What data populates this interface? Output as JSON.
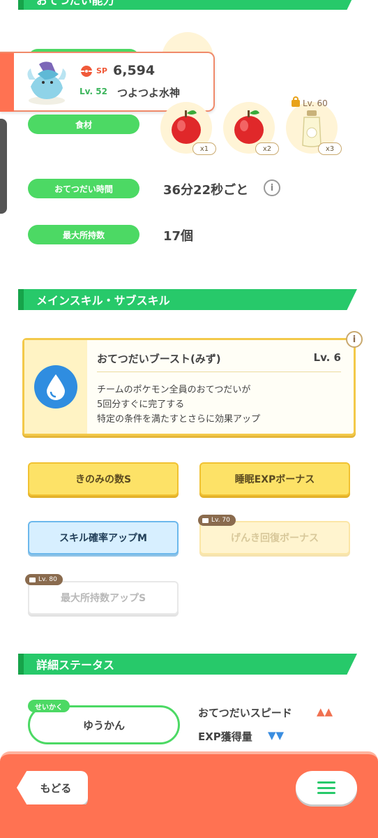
{
  "top_section": {
    "title": "おてつだい能力"
  },
  "pokemon_card": {
    "sp_label": "SP",
    "sp_value": "6,594",
    "level": "Lv. 52",
    "nickname": "つよつよ水神"
  },
  "stats": {
    "ingredients_label": "食材",
    "ingredients": [
      {
        "name": "apple-icon",
        "qty": "x1",
        "locked": false
      },
      {
        "name": "apple-icon",
        "qty": "x2",
        "locked": false
      },
      {
        "name": "oil-bottle-icon",
        "qty": "x3",
        "locked": true,
        "lock_level": "Lv. 60"
      }
    ],
    "help_time_label": "おてつだい時間",
    "help_time_value": "36分22秒ごと",
    "max_carry_label": "最大所持数",
    "max_carry_value": "17個"
  },
  "skills_section": {
    "title": "メインスキル・サブスキル",
    "main_skill": {
      "name": "おてつだいブースト(みず)",
      "level": "Lv. 6",
      "desc_1": "チームのポケモン全員のおてつだいが",
      "desc_2": "5回分すぐに完了する",
      "desc_3": "特定の条件を満たすとさらに効果アップ",
      "info_icon": "i"
    },
    "sub_skills": [
      {
        "label": "きのみの数S"
      },
      {
        "label": "睡眠EXPボーナス"
      },
      {
        "label": "スキル確率アップM"
      },
      {
        "label": "げんき回復ボーナス",
        "lock_level": "Lv. 70"
      },
      {
        "label": "最大所持数アップS",
        "lock_level": "Lv. 80"
      }
    ]
  },
  "detail_section": {
    "title": "詳細ステータス",
    "nature_tag": "せいかく",
    "nature": "ゆうかん",
    "up_stat": "おてつだいスピード",
    "up_arrows": "▲▲",
    "down_stat": "EXP獲得量",
    "down_arrows": "▼▼"
  },
  "bottom_bar": {
    "back_label": "もどる"
  },
  "colors": {
    "green": "#27c96a",
    "gold": "#fde267",
    "coral": "#ff7252",
    "blue": "#d7efff"
  }
}
